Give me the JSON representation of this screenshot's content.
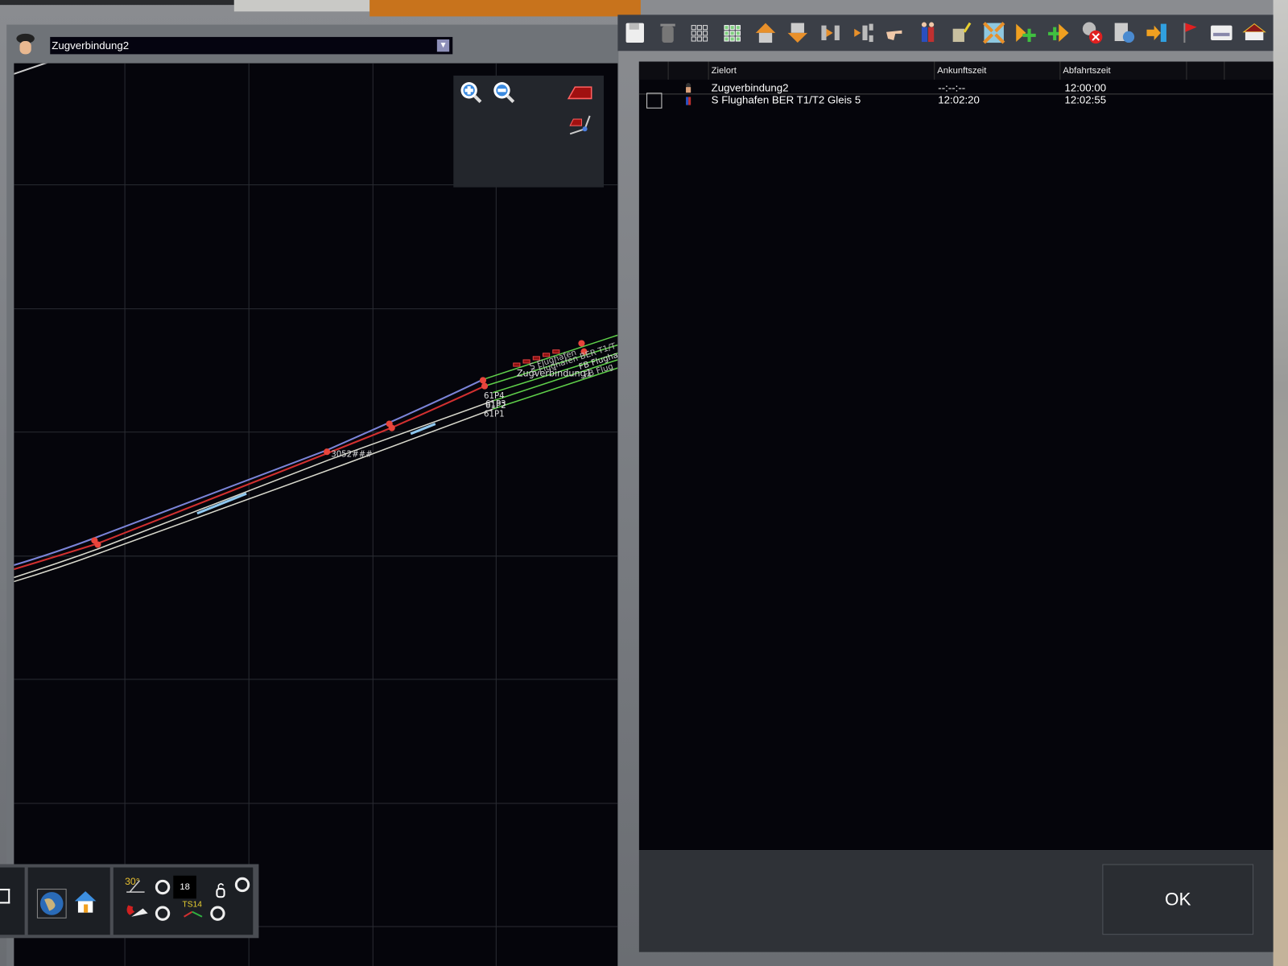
{
  "header": {
    "selected_train": "Zugverbindung2"
  },
  "map": {
    "labels": {
      "p4": "61P4",
      "p3": "61P3",
      "p2": "61P2",
      "p1": "61P1",
      "train1": "Zugverbindung1",
      "flug1": "S Flughafen",
      "flug2": "S Flughafen BER T1/T",
      "flug3": "FB Flughaf",
      "flug4": "FB Flug",
      "signal": "3052###"
    },
    "colors": {
      "track_blue": "#7b84d8",
      "track_red": "#d23030",
      "track_white": "#d8d8cc",
      "track_green": "#5fd04a",
      "marker": "#e8453c"
    }
  },
  "toolbar": {
    "icons": [
      "save-icon",
      "delete-icon",
      "grid-outline-icon",
      "grid-green-icon",
      "move-up-icon",
      "move-down-icon",
      "insert-after-icon",
      "insert-before-icon",
      "pointer-hand-icon",
      "passengers-icon",
      "refuel-icon",
      "collapse-icon",
      "add-after-icon",
      "add-before-icon",
      "remove-driver-icon",
      "settings-icon",
      "enter-icon",
      "flag-icon",
      "ticket-icon",
      "station-icon"
    ]
  },
  "table": {
    "columns": [
      "",
      "",
      "Zielort",
      "Ankunftszeit",
      "Abfahrtszeit",
      "",
      ""
    ],
    "rows": [
      {
        "zielort": "Zugverbindung2",
        "ankunft": "--:--:--",
        "abfahrt": "12:00:00"
      },
      {
        "zielort": "S Flughafen BER T1/T2 Gleis 5",
        "ankunft": "12:02:20",
        "abfahrt": "12:02:55"
      }
    ]
  },
  "bottom": {
    "angle_label": "30°",
    "value": "18",
    "ts_label": "TS14"
  },
  "footer": {
    "ok_label": "OK"
  }
}
